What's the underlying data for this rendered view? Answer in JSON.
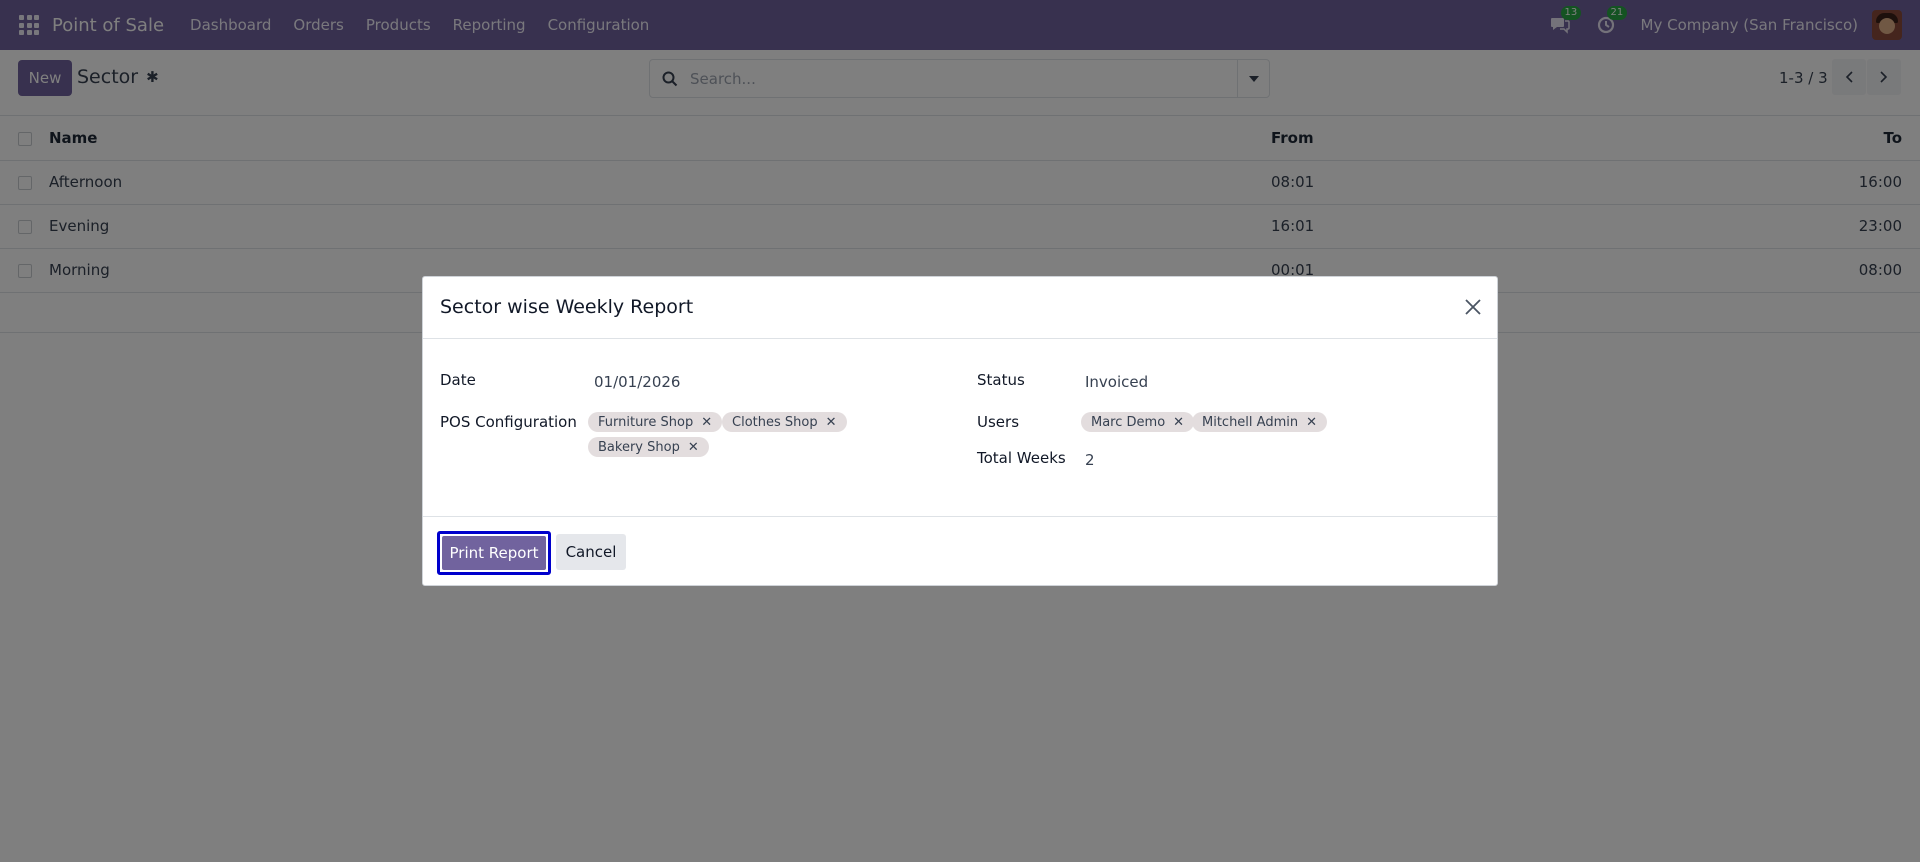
{
  "navbar": {
    "app_name": "Point of Sale",
    "menu": [
      "Dashboard",
      "Orders",
      "Products",
      "Reporting",
      "Configuration"
    ],
    "messages_count": "13",
    "activities_count": "21",
    "company": "My Company (San Francisco)"
  },
  "control": {
    "new_label": "New",
    "breadcrumb": "Sector",
    "search_placeholder": "Search...",
    "pager": "1-3 / 3"
  },
  "list": {
    "columns": {
      "name": "Name",
      "from": "From",
      "to": "To"
    },
    "rows": [
      {
        "name": "Afternoon",
        "from": "08:01",
        "to": "16:00"
      },
      {
        "name": "Evening",
        "from": "16:01",
        "to": "23:00"
      },
      {
        "name": "Morning",
        "from": "00:01",
        "to": "08:00"
      }
    ]
  },
  "dialog": {
    "title": "Sector wise Weekly Report",
    "date_label": "Date",
    "date_value": "01/01/2026",
    "status_label": "Status",
    "status_value": "Invoiced",
    "pos_label": "POS Configuration",
    "pos_tags": [
      "Furniture Shop",
      "Clothes Shop",
      "Bakery Shop"
    ],
    "users_label": "Users",
    "user_tags": [
      "Marc Demo",
      "Mitchell Admin"
    ],
    "weeks_label": "Total Weeks",
    "weeks_value": "2",
    "print_label": "Print Report",
    "cancel_label": "Cancel"
  },
  "colors": {
    "brand": "#71639e",
    "badge": "#28a745",
    "focus_outline": "#0000cc",
    "tag_bg": "#e3ddde"
  },
  "icons": [
    "apps-grid-icon",
    "chat-icon",
    "clock-icon",
    "gear-icon",
    "search-icon",
    "caret-down-icon",
    "chevron-left-icon",
    "chevron-right-icon",
    "close-icon",
    "tag-remove-icon"
  ]
}
